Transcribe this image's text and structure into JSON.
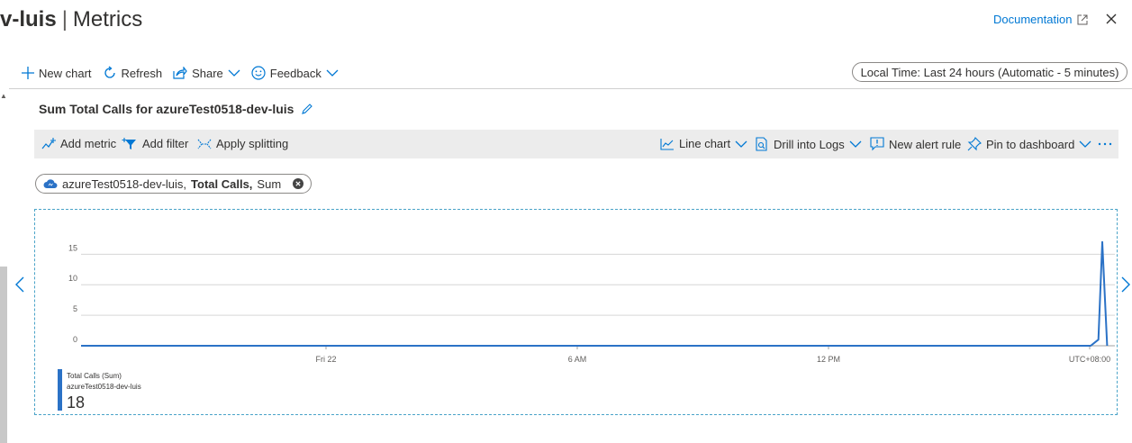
{
  "header": {
    "title_resource": "v-luis",
    "title_separator": "|",
    "title_section": "Metrics",
    "documentation_link": "Documentation"
  },
  "toolbar": {
    "new_chart": "New chart",
    "refresh": "Refresh",
    "share": "Share",
    "feedback": "Feedback",
    "time_range": "Local Time: Last 24 hours (Automatic - 5 minutes)"
  },
  "chart_panel": {
    "title": "Sum Total Calls for azureTest0518-dev-luis",
    "commands": {
      "add_metric": "Add metric",
      "add_filter": "Add filter",
      "apply_splitting": "Apply splitting",
      "line_chart": "Line chart",
      "drill_into_logs": "Drill into Logs",
      "new_alert_rule": "New alert rule",
      "pin_to_dashboard": "Pin to dashboard"
    },
    "metric_pill": {
      "resource": "azureTest0518-dev-luis,",
      "metric": "Total Calls,",
      "aggregation": "Sum"
    }
  },
  "chart_data": {
    "type": "line",
    "y_ticks": [
      "0",
      "5",
      "10",
      "15"
    ],
    "ylim": [
      0,
      18
    ],
    "x_ticks": [
      "Fri 22",
      "6 AM",
      "12 PM",
      "UTC+08:00"
    ],
    "series": [
      {
        "name": "Total Calls (Sum)",
        "resource": "azureTest0518-dev-luis",
        "color": "#2b72c6",
        "points": [
          [
            0,
            0
          ],
          [
            0.9766,
            0
          ],
          [
            0.9841,
            1
          ],
          [
            0.9878,
            17
          ],
          [
            0.9925,
            0
          ]
        ]
      }
    ],
    "legend_total": "18",
    "grid": true,
    "legend_placement": "bottom-left"
  },
  "colors": {
    "accent": "#0078d4",
    "series": "#2b72c6"
  }
}
